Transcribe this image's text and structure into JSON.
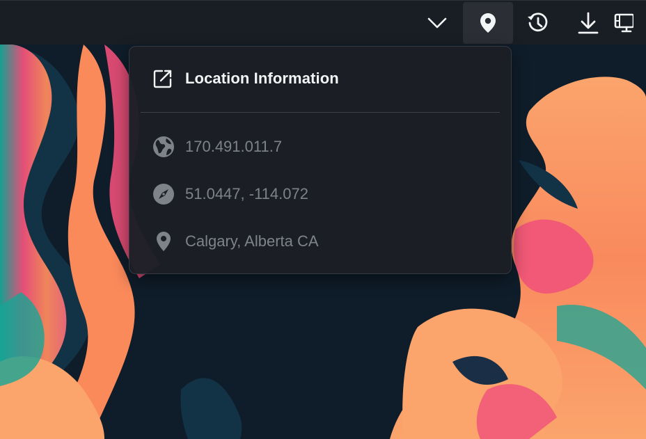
{
  "toolbar": {
    "buttons": [
      {
        "icon": "chevron-down-icon"
      },
      {
        "icon": "map-pin-icon",
        "active": true
      },
      {
        "icon": "history-icon"
      },
      {
        "icon": "download-icon"
      },
      {
        "icon": "monitor-icon"
      }
    ]
  },
  "popover": {
    "title": "Location Information",
    "title_icon": "external-link-icon",
    "rows": [
      {
        "icon": "globe-icon",
        "text": "170.491.011.7"
      },
      {
        "icon": "compass-icon",
        "text": "51.0447, -114.072"
      },
      {
        "icon": "map-pin-icon",
        "text": "Calgary, Alberta CA"
      }
    ]
  },
  "colors": {
    "background": "#0f1d2a",
    "accent_orange": "#f9a06a",
    "accent_pink": "#f0507a",
    "accent_teal": "#23a39a",
    "text_primary": "#f2f4f6",
    "text_secondary": "#7e838a"
  }
}
